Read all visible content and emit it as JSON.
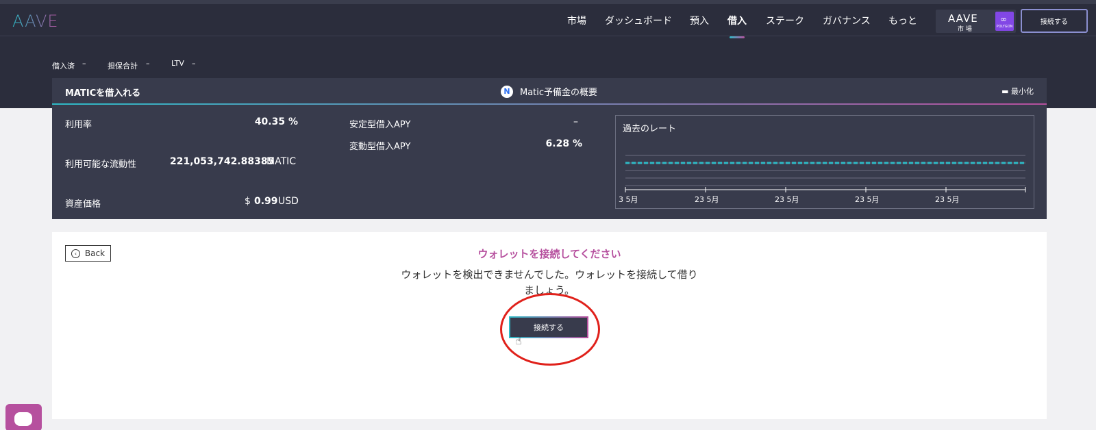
{
  "app": {
    "logo": "AAVE"
  },
  "nav": {
    "items": [
      "市場",
      "ダッシュボード",
      "預入",
      "借入",
      "ステーク",
      "ガバナンス",
      "もっと"
    ],
    "active": "借入"
  },
  "market": {
    "logo": "AAVE",
    "label": "市 場",
    "network": "POLYGON"
  },
  "header": {
    "connect_label": "接続する"
  },
  "stats": {
    "borrowed_label": "借入済",
    "borrowed_value": "–",
    "collateral_label": "担保合計",
    "collateral_value": "–",
    "ltv_label": "LTV",
    "ltv_value": "–"
  },
  "panel": {
    "title": "MATICを借入れる",
    "center_title": "Matic予備金の概要",
    "minimize_label": "最小化",
    "utilization_label": "利用率",
    "utilization_value": "40.35 %",
    "liquidity_label": "利用可能な流動性",
    "liquidity_value": "221,053,742.88385",
    "liquidity_unit": "MATIC",
    "price_label": "資産価格",
    "price_currency": "$",
    "price_value": "0.99",
    "price_unit": "USD",
    "stable_label": "安定型借入APY",
    "stable_value": "–",
    "variable_label": "変動型借入APY",
    "variable_value": "6.28 %",
    "chart_title": "過去のレート"
  },
  "chart_data": {
    "type": "line",
    "title": "過去のレート",
    "x_ticks": [
      "3 5月",
      "23 5月",
      "23 5月",
      "23 5月",
      "23 5月"
    ],
    "series": [
      {
        "values": [
          6.28,
          6.28,
          6.28,
          6.28,
          6.28,
          6.28,
          6.28,
          6.28,
          6.28,
          6.28
        ]
      }
    ],
    "grid": true
  },
  "card": {
    "back_label": "Back",
    "title": "ウォレットを接続してください",
    "description": "ウォレットを検出できませんでした。ウォレットを接続して借りましょう。",
    "connect_label": "接続する"
  },
  "colors": {
    "accent_teal": "#2ebac6",
    "accent_pink": "#b6509e",
    "annotation_red": "#e0211b"
  }
}
